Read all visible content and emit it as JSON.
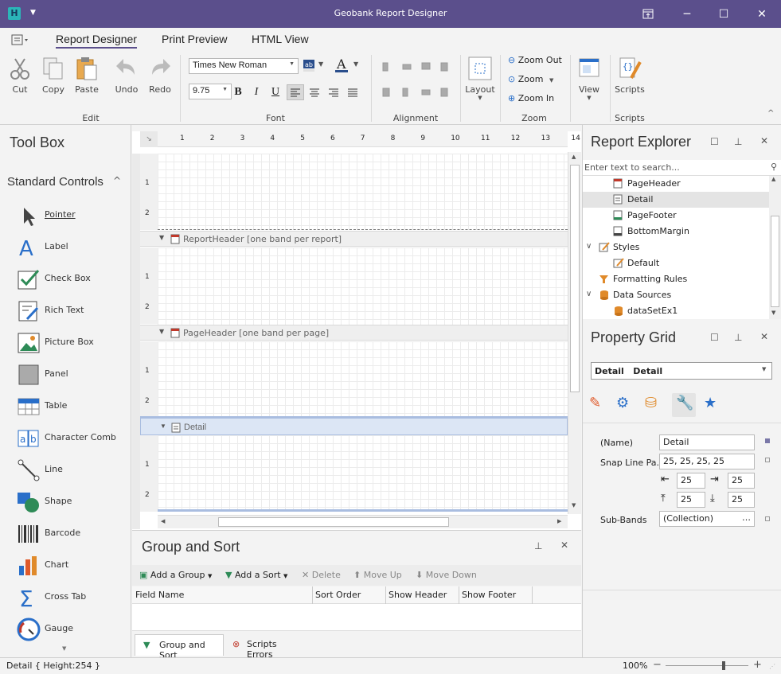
{
  "window": {
    "title": "Geobank Report Designer"
  },
  "tabs": [
    {
      "label": "Report Designer"
    },
    {
      "label": "Print Preview"
    },
    {
      "label": "HTML View"
    }
  ],
  "ribbon": {
    "edit": {
      "cut": "Cut",
      "copy": "Copy",
      "paste": "Paste",
      "group": "Edit"
    },
    "history": {
      "undo": "Undo",
      "redo": "Redo"
    },
    "font": {
      "family": "Times New Roman",
      "size": "9.75",
      "group": "Font"
    },
    "alignment": {
      "group": "Alignment"
    },
    "layout": {
      "label": "Layout"
    },
    "zoom": {
      "zoom_out": "Zoom Out",
      "zoom": "Zoom",
      "zoom_in": "Zoom In",
      "group": "Zoom"
    },
    "view": {
      "label": "View"
    },
    "scripts": {
      "label": "Scripts",
      "group": "Scripts"
    }
  },
  "toolbox": {
    "title": "Tool Box",
    "section": "Standard Controls",
    "items": [
      "Pointer",
      "Label",
      "Check Box",
      "Rich Text",
      "Picture Box",
      "Panel",
      "Table",
      "Character Comb",
      "Line",
      "Shape",
      "Barcode",
      "Chart",
      "Cross Tab",
      "Gauge"
    ]
  },
  "ruler": {
    "ticks": [
      "1",
      "2",
      "3",
      "4",
      "5",
      "6",
      "7",
      "8",
      "9",
      "10",
      "11",
      "12",
      "13",
      "14"
    ]
  },
  "bands": {
    "report_header": "ReportHeader [one band per report]",
    "page_header": "PageHeader [one band per page]",
    "detail": "Detail",
    "vruler": [
      "1",
      "2"
    ]
  },
  "group_sort": {
    "title": "Group and Sort",
    "add_group": "Add a Group",
    "add_sort": "Add a Sort",
    "delete": "Delete",
    "move_up": "Move Up",
    "move_down": "Move Down",
    "columns": [
      "Field Name",
      "Sort Order",
      "Show Header",
      "Show Footer"
    ],
    "tabs": [
      "Group and Sort",
      "Scripts Errors"
    ]
  },
  "explorer": {
    "title": "Report Explorer",
    "search_placeholder": "Enter text to search...",
    "items": [
      "PageHeader",
      "Detail",
      "PageFooter",
      "BottomMargin",
      "Styles",
      "Default",
      "Formatting Rules",
      "Data Sources",
      "dataSetEx1"
    ]
  },
  "property_grid": {
    "title": "Property Grid",
    "selected": "Detail   Detail",
    "name_label": "(Name)",
    "name_value": "Detail",
    "snap_label": "Snap Line Pa...",
    "snap_value": "25, 25, 25, 25",
    "snap_left": "25",
    "snap_right": "25",
    "snap_top": "25",
    "snap_bottom": "25",
    "subbands_label": "Sub-Bands",
    "subbands_value": "(Collection)"
  },
  "status": {
    "left": "Detail { Height:254 }",
    "zoom": "100%"
  },
  "zoom_level": 0.7,
  "colors": {
    "titlebar": "#5b4f8c",
    "accent": "#2a6fc9"
  }
}
